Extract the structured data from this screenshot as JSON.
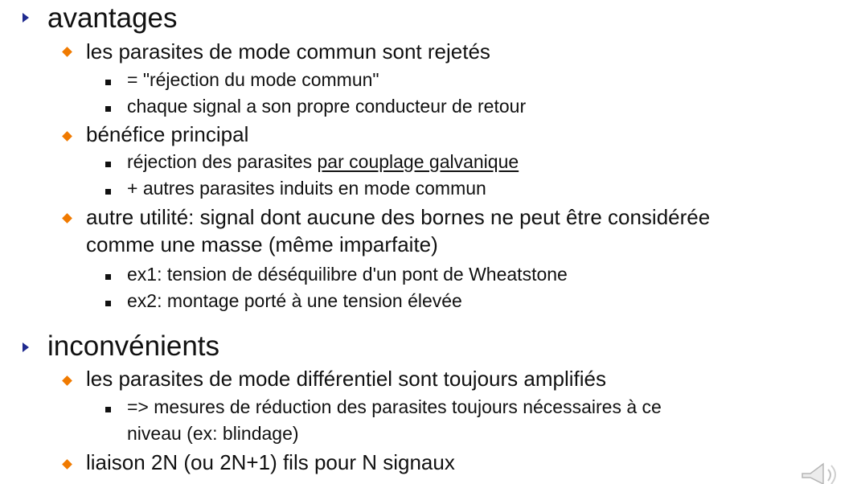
{
  "slide": {
    "sections": {
      "avantages": {
        "title": "avantages",
        "items": {
          "rejet": {
            "text": "les parasites de mode commun sont rejetés",
            "sub": {
              "eq": "= \"réjection du mode commun\"",
              "retour": "chaque signal a son propre conducteur de retour"
            }
          },
          "benefice": {
            "text": "bénéfice principal",
            "sub": {
              "galv_prefix": "réjection des parasites ",
              "galv_underlined": "par couplage galvanique",
              "autres": "+ autres parasites induits en mode commun"
            }
          },
          "utilite": {
            "line1": "autre utilité: signal dont aucune des bornes ne peut être considérée",
            "line2": "comme une masse (même imparfaite)",
            "sub": {
              "ex1": "ex1: tension de déséquilibre d'un pont de Wheatstone",
              "ex2": "ex2: montage porté à une tension élevée"
            }
          }
        }
      },
      "inconvenients": {
        "title": "inconvénients",
        "items": {
          "differentiel": {
            "text": "les parasites de mode différentiel sont toujours amplifiés",
            "sub": {
              "mesures_line1": "=> mesures de réduction des parasites toujours nécessaires à ce",
              "mesures_line2": "niveau (ex: blindage)"
            }
          },
          "liaison": {
            "text": "liaison 2N (ou 2N+1) fils pour N signaux"
          }
        }
      }
    },
    "colors": {
      "level1_bullet": "#1f2a8f",
      "level2_bullet": "#f07a00",
      "level3_bullet": "#111111"
    },
    "icons": {
      "corner": "speaker-icon"
    }
  }
}
